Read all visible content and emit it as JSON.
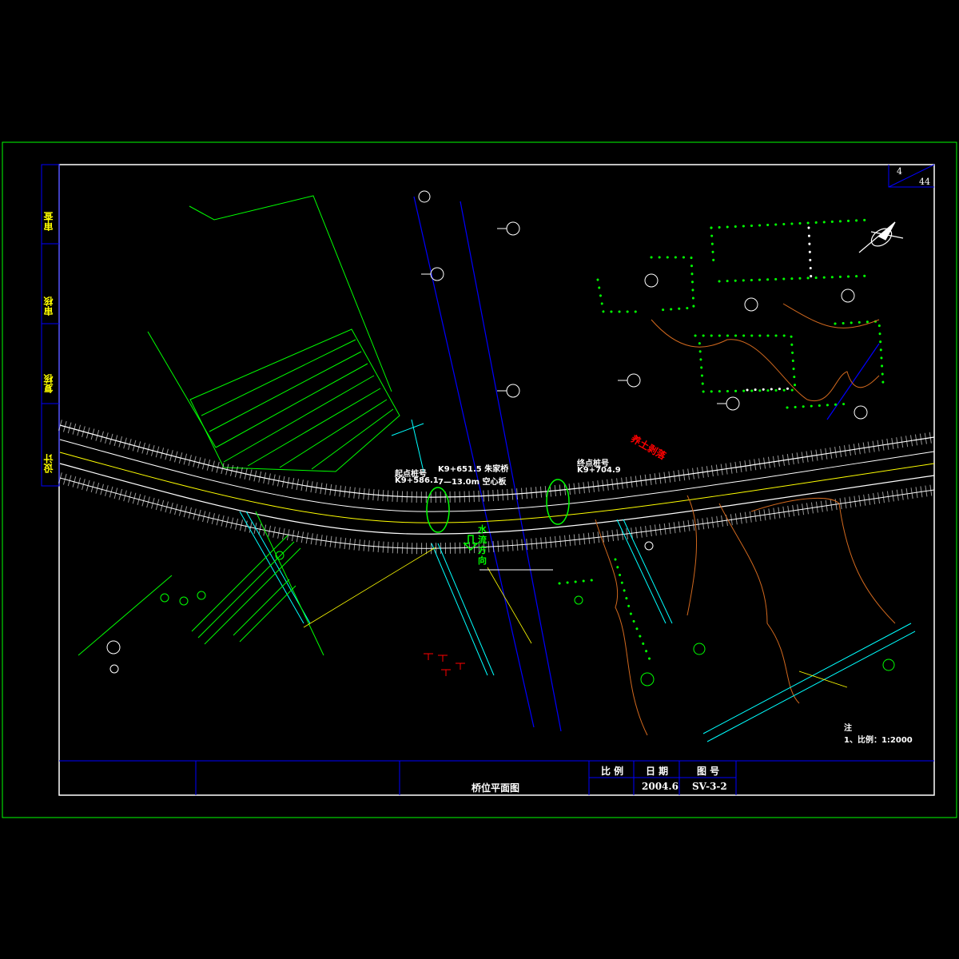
{
  "sheet": {
    "page": "4",
    "total_pages": "44"
  },
  "side_labels": [
    "审查",
    "审核",
    "复核",
    "设计"
  ],
  "title_block": {
    "drawing_title": "桥位平面图",
    "scale_header": "比 例",
    "date_header": "日 期",
    "number_header": "图 号",
    "date": "2004.6",
    "drawing_number": "SV-3-2"
  },
  "annotations": {
    "start_station_label": "起点桩号",
    "start_station": "K9+586.1",
    "bridge_station": "K9+651.5 朱家桥",
    "bridge_desc": "7—13.0m 空心板",
    "end_station_label": "终点桩号",
    "end_station": "K9+704.9",
    "flow_direction": "水流方向",
    "red_label": "养土剥落"
  },
  "notes": {
    "header": "注",
    "scale_note": "1、比例：1:2000"
  },
  "colors": {
    "frame": "#00ff00",
    "border": "#ffffff",
    "title_lines": "#0000ff",
    "road": "#ffffff",
    "centerline": "#ffff00",
    "river": "#0000ff",
    "cyan": "#00ffff",
    "terrain": "#ff7f00",
    "red_text": "#ff0000"
  }
}
